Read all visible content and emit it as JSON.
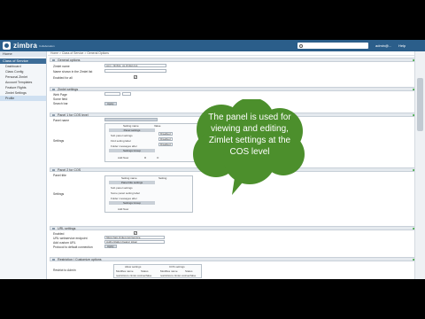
{
  "app": {
    "logo": "zimbra",
    "logo_sub": "Collaboration",
    "user": "admin@...",
    "help": "Help"
  },
  "search": {
    "placeholder": ""
  },
  "sidebar": {
    "tab": "Home",
    "section": "Class of Service",
    "items": [
      "Dashboard",
      "Class Config",
      "Personal Zimlet",
      "Account Templates",
      "Feature Rights",
      "Zimlet Settings",
      "Profile"
    ]
  },
  "breadcrumb": "Home > Class of Service > General Options",
  "sections": {
    "general": {
      "title": "General options",
      "fields": [
        {
          "label": "Zimlet name",
          "value": "com_zimbra_ux.zimlet.cos"
        },
        {
          "label": "Name shown in the Zimlet list",
          "value": ""
        },
        {
          "label": "Enabled for all",
          "value": ""
        }
      ]
    },
    "zimlet_settings": {
      "title": "Zimlet settings",
      "labels": [
        "Web Page",
        "Some field",
        "Search bar"
      ],
      "button": "Apply"
    },
    "panel_cos": {
      "title": "Panel 1 for COS level",
      "label1": "Panel name",
      "label2": "Settings",
      "cols": [
        "Setting name",
        "Value"
      ],
      "items": [
        "Panel settings",
        "Sub panel settings",
        "Find setting label",
        "Folder messages after",
        "Settings Group"
      ],
      "dropdowns": [
        "Disabled",
        "Disabled",
        "Disabled"
      ],
      "add": "Add New",
      "r": "R",
      "o": "O"
    },
    "panel_cos2": {
      "title": "Panel 2 for COS",
      "label1": "Panel title",
      "label2": "Settings",
      "cols": [
        "Setting name",
        "Setting"
      ],
      "items": [
        "Panel title settings",
        "Sub panel settings",
        "Some panel setting label",
        "Folder messages after",
        "Settings Group"
      ],
      "add": "Add New"
    },
    "url_settings": {
      "title": "URL settings",
      "fields": [
        {
          "label": "Enabled",
          "value": ""
        },
        {
          "label": "URL webservice endpoint",
          "value": "https://api.zimlet.com/service"
        },
        {
          "label": "Add custom URL",
          "value": "Authorization bearer token"
        },
        {
          "label": "Protocol to default connection",
          "value": ""
        }
      ],
      "button": "Apply"
    },
    "restrictions": {
      "title": "Restriction / Customize options",
      "label": "Restrict to Admin",
      "cols": [
        "Allow settings",
        "COS settings"
      ],
      "subcols": [
        "Modifies name",
        "Status",
        "Modifies name",
        "Status"
      ],
      "vals": [
        "restrictions.zimlet.cos",
        "true/false",
        "restrictions.zimlet.cos",
        "true/false"
      ]
    }
  },
  "callout": {
    "text": "The panel is used for viewing and editing, Zimlet settings at the COS level",
    "color": "#4c8f2c"
  }
}
